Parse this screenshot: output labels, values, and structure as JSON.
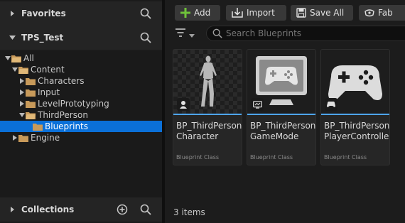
{
  "sidebar": {
    "favorites": {
      "label": "Favorites"
    },
    "project": {
      "label": "TPS_Test"
    },
    "tree": [
      {
        "label": "All",
        "depth": 0,
        "expanded": true,
        "selected": false
      },
      {
        "label": "Content",
        "depth": 1,
        "expanded": true,
        "selected": false
      },
      {
        "label": "Characters",
        "depth": 2,
        "expanded": false,
        "selected": false
      },
      {
        "label": "Input",
        "depth": 2,
        "expanded": false,
        "selected": false
      },
      {
        "label": "LevelPrototyping",
        "depth": 2,
        "expanded": false,
        "selected": false
      },
      {
        "label": "ThirdPerson",
        "depth": 2,
        "expanded": true,
        "selected": false
      },
      {
        "label": "Blueprints",
        "depth": 3,
        "expanded": false,
        "selected": true
      },
      {
        "label": "Engine",
        "depth": 1,
        "expanded": false,
        "selected": false
      }
    ],
    "collections": {
      "label": "Collections"
    }
  },
  "toolbar": {
    "add_label": "Add",
    "import_label": "Import",
    "save_all_label": "Save All",
    "fab_label": "Fab"
  },
  "search": {
    "placeholder": "Search Blueprints"
  },
  "assets": [
    {
      "name": "BP_ThirdPerson\nCharacter",
      "kind": "Blueprint Class",
      "icon": "character-icon"
    },
    {
      "name": "BP_ThirdPerson\nGameMode",
      "kind": "Blueprint Class",
      "icon": "gamemode-icon"
    },
    {
      "name": "BP_ThirdPerson\nPlayerController",
      "kind": "Blueprint Class",
      "icon": "controller-icon"
    }
  ],
  "status": {
    "item_count": "3 items"
  },
  "colors": {
    "accent": "#0b70d8",
    "asset_bar": "#4ea5f5",
    "folder": "#c89a5a",
    "add_green": "#6fc23a"
  }
}
